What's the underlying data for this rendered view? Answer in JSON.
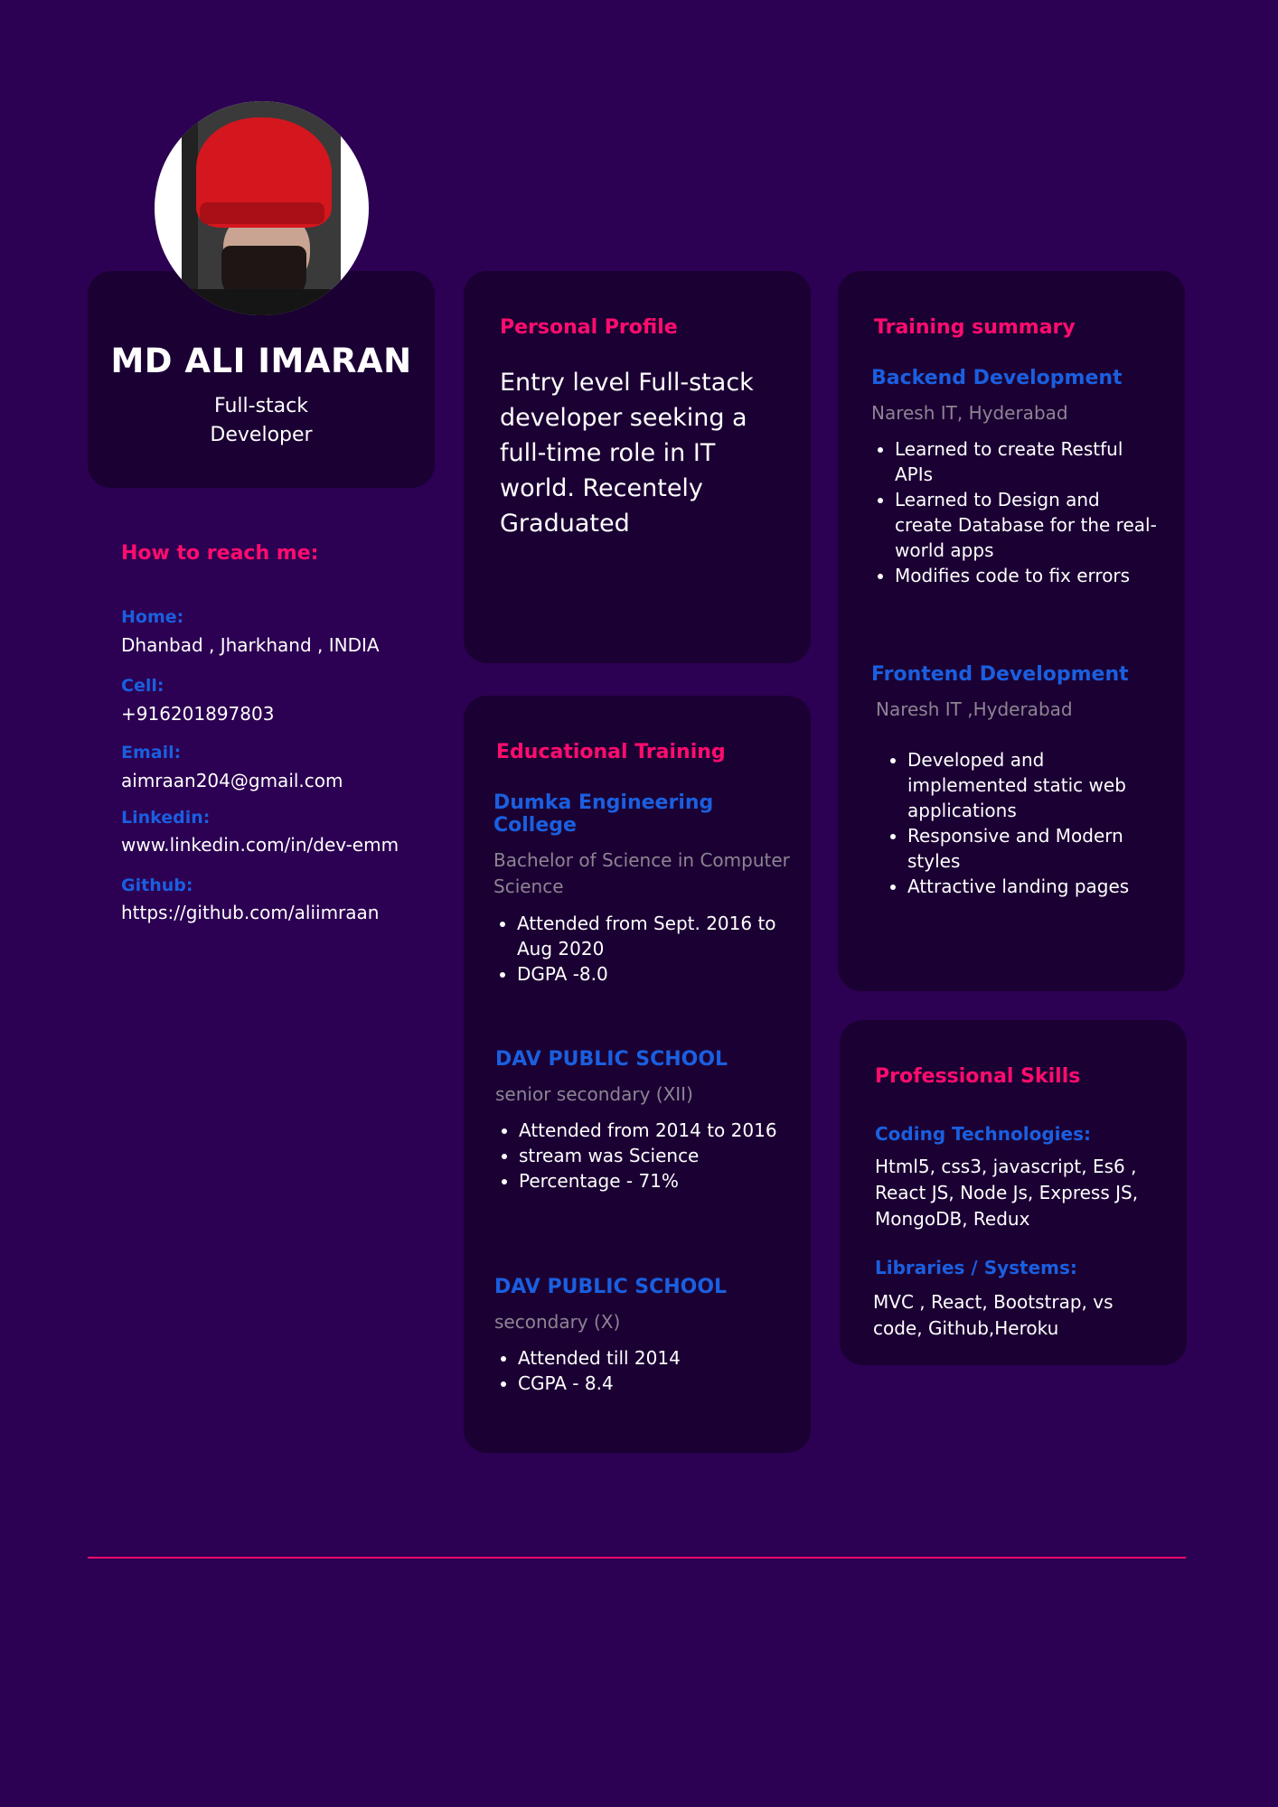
{
  "profile": {
    "name": "MD ALI IMARAN",
    "role_line1": "Full-stack",
    "role_line2": "Developer"
  },
  "contact": {
    "title": "How to reach me:",
    "home_label": "Home:",
    "home_value": "Dhanbad , Jharkhand , INDIA",
    "cell_label": "Cell:",
    "cell_value": "+916201897803",
    "email_label": "Email:",
    "email_value": "aimraan204@gmail.com",
    "linkedin_label": "Linkedin:",
    "linkedin_value": "www.linkedin.com/in/dev-emm",
    "github_label": "Github:",
    "github_value": "https://github.com/aliimraan"
  },
  "personal": {
    "title": "Personal Profile",
    "text": "Entry level Full-stack developer seeking a full-time role in IT world. Recentely Graduated"
  },
  "education": {
    "title": "Educational Training",
    "entries": [
      {
        "school": "Dumka Engineering College",
        "degree": "Bachelor of Science in Computer Science",
        "items": [
          "Attended from Sept. 2016 to Aug 2020",
          "DGPA -8.0"
        ]
      },
      {
        "school": "DAV PUBLIC SCHOOL",
        "degree": "senior secondary (XII)",
        "items": [
          "Attended from 2014 to 2016",
          "stream was Science",
          "Percentage - 71%"
        ]
      },
      {
        "school": "DAV PUBLIC SCHOOL",
        "degree": "secondary (X)",
        "items": [
          "Attended till 2014",
          "CGPA - 8.4"
        ]
      }
    ]
  },
  "training": {
    "title": "Training summary",
    "backend": {
      "heading": "Backend Development",
      "place": "Naresh IT, Hyderabad",
      "items": [
        "Learned to create Restful APIs",
        "Learned to Design and create Database for the real-world apps",
        "Modifies code to fix errors"
      ]
    },
    "frontend": {
      "heading": "Frontend Development",
      "place": "Naresh IT ,Hyderabad",
      "items": [
        "Developed and implemented static web applications",
        "Responsive and Modern styles",
        "Attractive landing pages"
      ]
    }
  },
  "skills": {
    "title": "Professional Skills",
    "coding_label": "Coding Technologies:",
    "coding_value": "Html5, css3, javascript, Es6 , React JS, Node Js, Express JS, MongoDB, Redux",
    "libs_label": "Libraries / Systems:",
    "libs_value": "MVC , React, Bootstrap, vs code, Github,Heroku"
  },
  "colors": {
    "background": "#2c0052",
    "card": "#1b0033",
    "accent_pink": "#ff0c6e",
    "accent_blue": "#1a5fe0",
    "muted": "#8d8492"
  }
}
